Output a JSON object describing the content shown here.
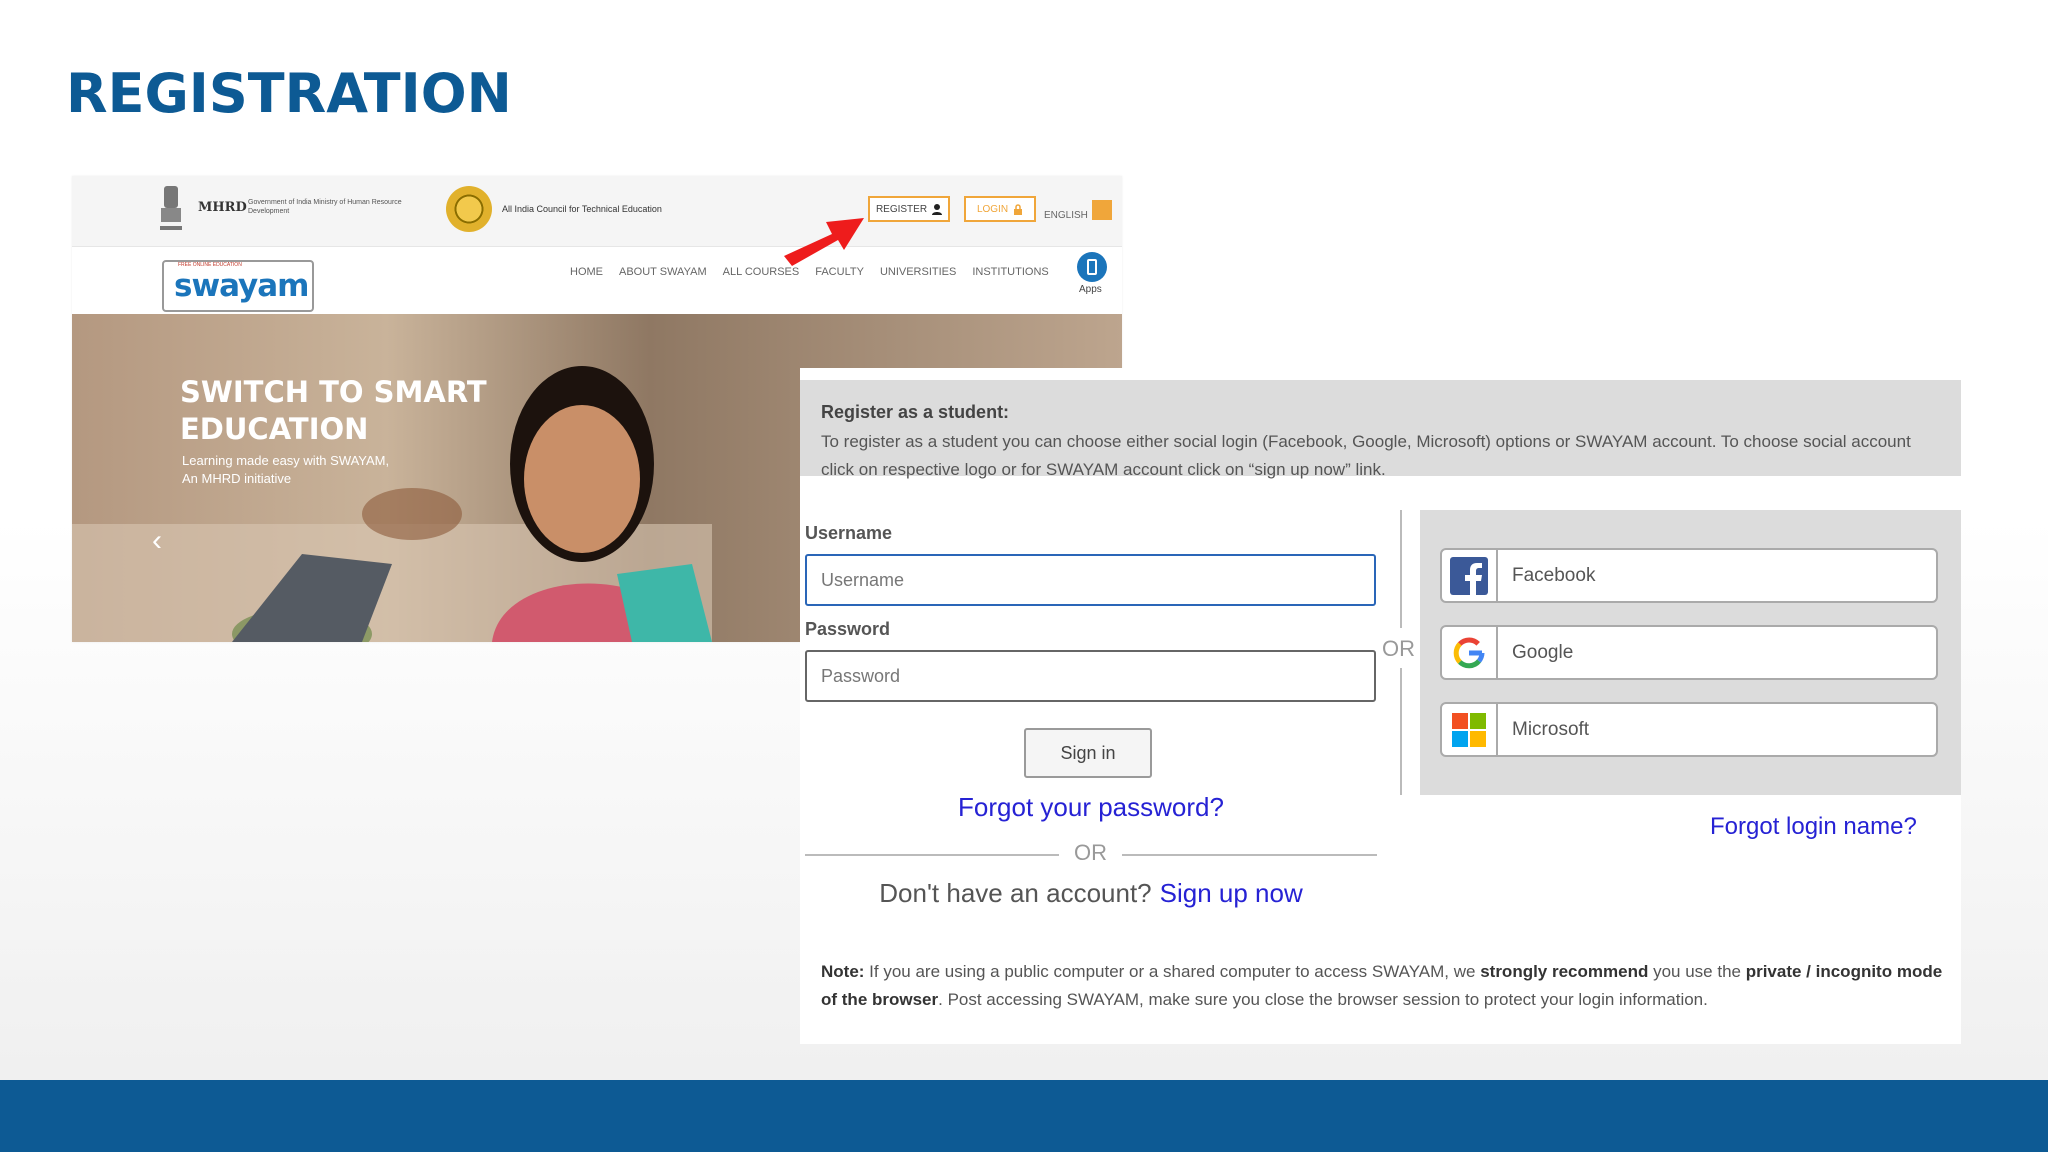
{
  "slide": {
    "title": "REGISTRATION"
  },
  "site": {
    "mhrd": "MHRD",
    "mhrd_sub": "Government of India Ministry of Human Resource Development",
    "aicte": "All India Council for Technical Education",
    "register": "REGISTER",
    "login": "LOGIN",
    "language": "ENGLISH",
    "logo_text": "swayam",
    "logo_tag": "FREE ONLINE EDUCATION",
    "nav": [
      "HOME",
      "ABOUT SWAYAM",
      "ALL COURSES",
      "FACULTY",
      "UNIVERSITIES",
      "INSTITUTIONS"
    ],
    "apps": "Apps",
    "hero_line1": "SWITCH TO SMART",
    "hero_line2": "EDUCATION",
    "hero_sub1": "Learning made easy with SWAYAM,",
    "hero_sub2": "An MHRD initiative",
    "prev": "‹"
  },
  "panel": {
    "info_title": "Register as a student:",
    "info_text": "To register as a student you can choose either social login (Facebook, Google, Microsoft) options or SWAYAM account. To choose social account click on respective logo or for SWAYAM account click on “sign up now” link.",
    "username_label": "Username",
    "username_placeholder": "Username",
    "password_label": "Password",
    "password_placeholder": "Password",
    "signin": "Sign in",
    "forgot_password": "Forgot your password?",
    "or": "OR",
    "no_account": "Don't have an account?",
    "signup": "Sign up now",
    "social": [
      {
        "label": "Facebook",
        "icon": "facebook-icon"
      },
      {
        "label": "Google",
        "icon": "google-icon"
      },
      {
        "label": "Microsoft",
        "icon": "microsoft-icon"
      }
    ],
    "forgot_login": "Forgot login name?",
    "note": {
      "lead": "Note:",
      "t1": " If you are using a public computer or a shared computer to access SWAYAM, we ",
      "b1": "strongly recommend",
      "t2": " you use the ",
      "b2": "private / incognito mode of the browser",
      "t3": ". Post accessing SWAYAM, make sure you close the browser session to protect your login information."
    }
  },
  "colors": {
    "title": "#0d5a94",
    "link": "#2622d4",
    "accent": "#f0a63a",
    "arrow": "#ee1c1c"
  }
}
